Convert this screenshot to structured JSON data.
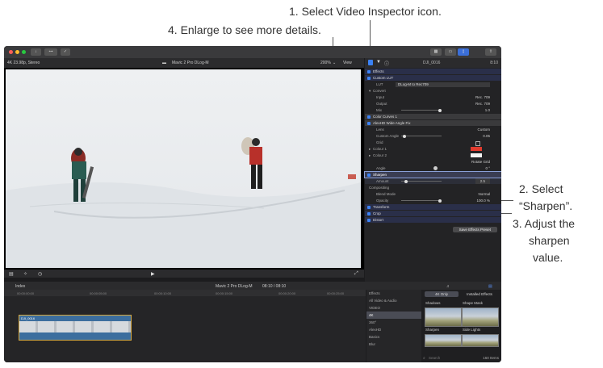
{
  "callouts": {
    "select_inspector": "1. Select Video Inspector icon.",
    "enlarge": "4. Enlarge to see more details.",
    "select_sharpen_1": "2. Select",
    "select_sharpen_2": "“Sharpen”.",
    "adjust_1": "3. Adjust the",
    "adjust_2": "sharpen",
    "adjust_3": "value."
  },
  "viewer": {
    "format": "4K 23.98p, Stereo",
    "clip_name": "Mavic 2 Pro DLog-M",
    "zoom": "200%",
    "view": "View"
  },
  "inspector": {
    "clip_name": "DJI_0016",
    "duration": "8:10",
    "rows": {
      "effects": "Effects",
      "custom_lut": "Custom LUT",
      "lut_label": "LUT",
      "lut_value": "DLog-M to Rec709",
      "convert": "Convert",
      "input_label": "Input",
      "input_value": "Rec. 709",
      "output_label": "Output",
      "output_value": "Rec. 709",
      "mix_label": "Mix",
      "mix_value": "1.0",
      "color_curves": "Color Curves 1",
      "wide_angle": "AlexHD Wide Angle Fix",
      "lens_label": "Lens",
      "lens_value": "Custom",
      "custom_angle_label": "Custom Angle",
      "custom_angle_value": "0.05",
      "grid_label": "Grid",
      "colour1_label": "Colour 1",
      "colour2_label": "Colour 2",
      "rotate_grid": "Rotate Grid",
      "angle_label": "Angle",
      "angle_value": "0 °",
      "sharpen": "Sharpen",
      "amount_label": "Amount",
      "amount_value": "2.5",
      "compositing": "Compositing",
      "blend_mode_label": "Blend Mode",
      "blend_mode_value": "Normal",
      "opacity_label": "Opacity",
      "opacity_value": "100.0 %",
      "transform": "Transform",
      "crop": "Crop",
      "distort": "Distort"
    },
    "save_preset": "Save Effects Preset",
    "colour1_hex": "#e23b2e",
    "colour2_hex": "#f4f4f4"
  },
  "index_bar": {
    "index": "Index",
    "clip_title": "Mavic 2 Pro DLog-M",
    "timecode": "08:10 / 08:10"
  },
  "timeline": {
    "ruler": [
      "00:00:00:00",
      "00:00:05:00",
      "00:00:10:00",
      "00:00:15:00",
      "00:00:20:00",
      "00:00:25:00",
      "00:00"
    ],
    "clip_label": "DJI_0016"
  },
  "effects_browser": {
    "header": "Effects",
    "categories": [
      "All Video & Audio",
      "VIDEO",
      "4K",
      "360°",
      "AlexHD",
      "Basics",
      "Blur"
    ],
    "selected_category": "4K",
    "tab_4k_only": "4K Only",
    "tab_installed": "Installed Effects",
    "thumbs": [
      "Shadows",
      "Shape Mask",
      "Sharpen",
      "Side Lights"
    ],
    "search": "Search",
    "count": "160 Items"
  }
}
